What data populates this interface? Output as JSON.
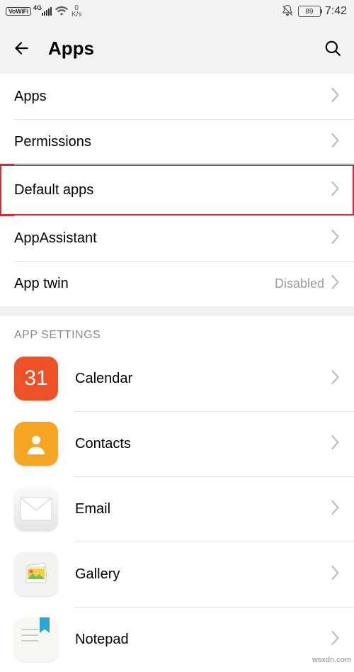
{
  "status": {
    "vowifi": "VoWiFi",
    "net_tech": "4G",
    "net_speed_top": "0",
    "net_speed_bottom": "K/s",
    "battery": "89",
    "time": "7:42"
  },
  "header": {
    "title": "Apps"
  },
  "items": [
    {
      "label": "Apps"
    },
    {
      "label": "Permissions"
    },
    {
      "label": "Default apps",
      "highlight": true
    },
    {
      "label": "AppAssistant"
    },
    {
      "label": "App twin",
      "value": "Disabled"
    }
  ],
  "section_header": "APP SETTINGS",
  "apps": [
    {
      "label": "Calendar",
      "icon_text": "31",
      "icon_class": "ic-calendar",
      "icon_name": "calendar-icon"
    },
    {
      "label": "Contacts",
      "icon_text": "",
      "icon_class": "ic-contacts",
      "icon_name": "contacts-icon"
    },
    {
      "label": "Email",
      "icon_text": "",
      "icon_class": "ic-email",
      "icon_name": "email-icon"
    },
    {
      "label": "Gallery",
      "icon_text": "",
      "icon_class": "ic-gallery",
      "icon_name": "gallery-icon"
    },
    {
      "label": "Notepad",
      "icon_text": "",
      "icon_class": "ic-notepad",
      "icon_name": "notepad-icon"
    }
  ],
  "watermark": "wsxdn.com"
}
